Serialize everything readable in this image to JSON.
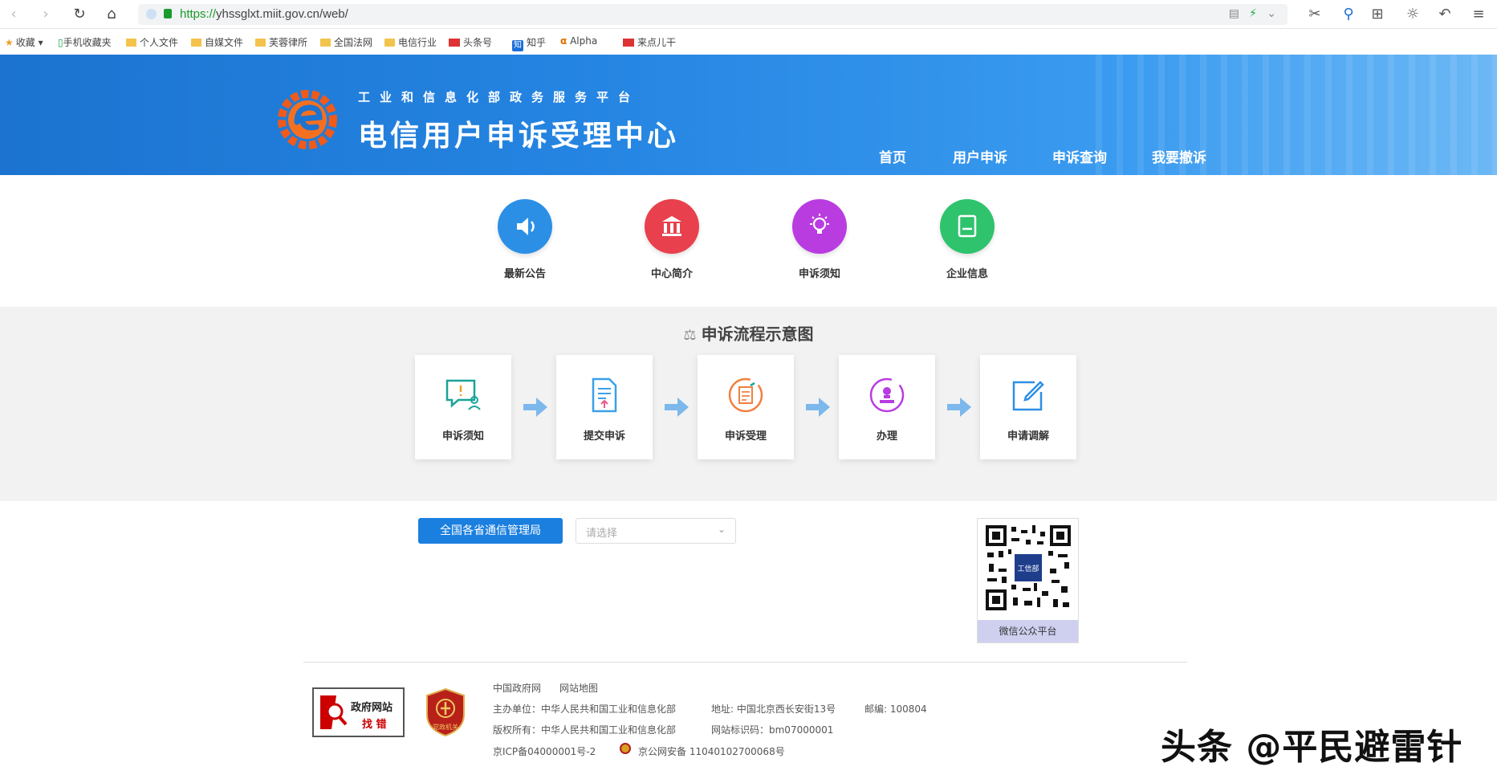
{
  "browser": {
    "url_scheme": "https://",
    "url_rest": "yhssglxt.miit.gov.cn/web/",
    "bookmarks": [
      "收藏",
      "手机收藏夹",
      "个人文件",
      "自媒文件",
      "芙蓉律所",
      "全国法网",
      "电信行业",
      "头条号",
      "知乎",
      "Alpha",
      "来点儿干"
    ]
  },
  "header": {
    "subtitle": "工业和信息化部政务服务平台",
    "title": "电信用户申诉受理中心",
    "nav": [
      "首页",
      "用户申诉",
      "申诉查询",
      "我要撤诉"
    ]
  },
  "quick_links": [
    {
      "label": "最新公告",
      "color": "#2c8fe6",
      "icon": "speaker-icon"
    },
    {
      "label": "中心简介",
      "color": "#e8404d",
      "icon": "building-icon"
    },
    {
      "label": "申诉须知",
      "color": "#b93ce0",
      "icon": "lightbulb-icon"
    },
    {
      "label": "企业信息",
      "color": "#2fc36e",
      "icon": "book-icon"
    }
  ],
  "flow": {
    "title": "申诉流程示意图",
    "steps": [
      "申诉须知",
      "提交申诉",
      "申诉受理",
      "办理",
      "申请调解"
    ]
  },
  "province": {
    "button": "全国各省通信管理局",
    "placeholder": "请选择"
  },
  "qr": {
    "caption": "微信公众平台",
    "center_text": "工信部"
  },
  "footer": {
    "badge1_line1": "政府网站",
    "badge1_line2": "找 错",
    "badge2_text": "党政机关",
    "links": [
      "中国政府网",
      "网站地图"
    ],
    "host": "主办单位：中华人民共和国工业和信息化部",
    "address": "地址: 中国北京西长安街13号",
    "postcode": "邮编: 100804",
    "copyright": "版权所有：中华人民共和国工业和信息化部",
    "site_id": "网站标识码：bm07000001",
    "icp": "京ICP备04000001号-2",
    "police": "京公网安备 11040102700068号"
  },
  "watermark": "头条 @平民避雷针"
}
